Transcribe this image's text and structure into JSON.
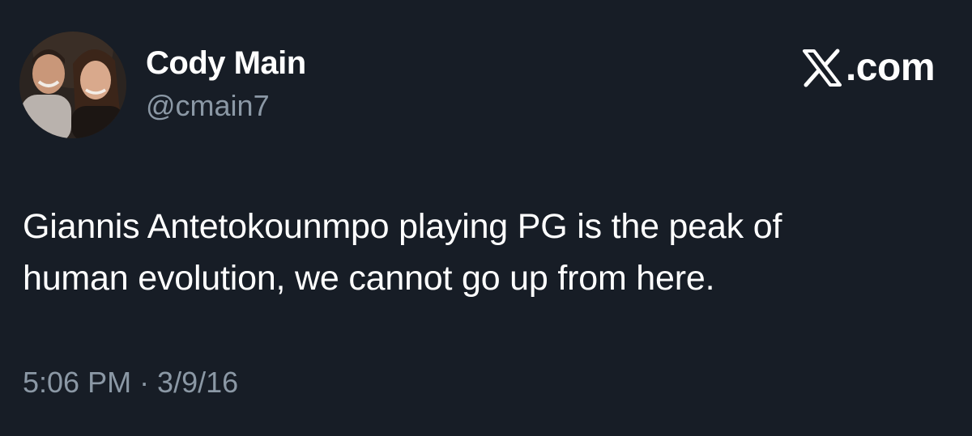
{
  "author": {
    "display_name": "Cody Main",
    "handle": "@cmain7",
    "avatar_icon": "profile-photo-avatar"
  },
  "brand": {
    "icon": "x-logo-icon",
    "text": ".com"
  },
  "tweet": {
    "lines": [
      "Giannis Antetokounmpo playing PG is the peak of",
      "human evolution, we cannot go up from here."
    ]
  },
  "meta": {
    "timestamp": "5:06 PM · 3/9/16"
  },
  "colors": {
    "background": "#171d26",
    "primary_text": "#ffffff",
    "secondary_text": "#8b98a5"
  }
}
